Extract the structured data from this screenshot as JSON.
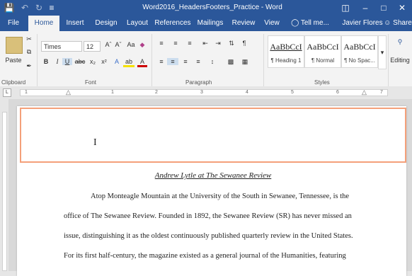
{
  "titlebar": {
    "title": "Word2016_HeadersFooters_Practice - Word",
    "save_icon": "save-icon",
    "undo_icon": "undo-icon",
    "redo_icon": "redo-icon"
  },
  "tabs": [
    {
      "label": "File"
    },
    {
      "label": "Home"
    },
    {
      "label": "Insert"
    },
    {
      "label": "Design"
    },
    {
      "label": "Layout"
    },
    {
      "label": "References"
    },
    {
      "label": "Mailings"
    },
    {
      "label": "Review"
    },
    {
      "label": "View"
    }
  ],
  "tell_me": "Tell me...",
  "user_name": "Javier Flores",
  "share_label": "Share",
  "ribbon": {
    "paste_label": "Paste",
    "clipboard_label": "Clipboard",
    "font_name": "Times",
    "font_size": "12",
    "font_group_label": "Font",
    "paragraph_group_label": "Paragraph",
    "styles_group_label": "Styles",
    "editing_label": "Editing",
    "styles": [
      {
        "preview": "AaBbCcI",
        "name": "¶ Heading 1"
      },
      {
        "preview": "AaBbCcI",
        "name": "¶ Normal"
      },
      {
        "preview": "AaBbCcI",
        "name": "¶ No Spac..."
      }
    ]
  },
  "ruler_numbers": [
    "1",
    "1",
    "2",
    "3",
    "4",
    "5",
    "6",
    "7"
  ],
  "document": {
    "title": "Andrew Lytle at The Sewanee Review",
    "lines": [
      "Atop Monteagle Mountain at the University of the South in Sewanee, Tennessee, is the",
      "office of The Sewanee Review. Founded in 1892, the Sewanee Review (SR) has never missed an",
      "issue, distinguishing it as the oldest continuously published quarterly review in the United States.",
      "For its first half-century, the magazine existed as a general journal of the Humanities, featuring"
    ]
  },
  "colors": {
    "accent": "#2b579a",
    "header_outline": "#f4a07a"
  }
}
